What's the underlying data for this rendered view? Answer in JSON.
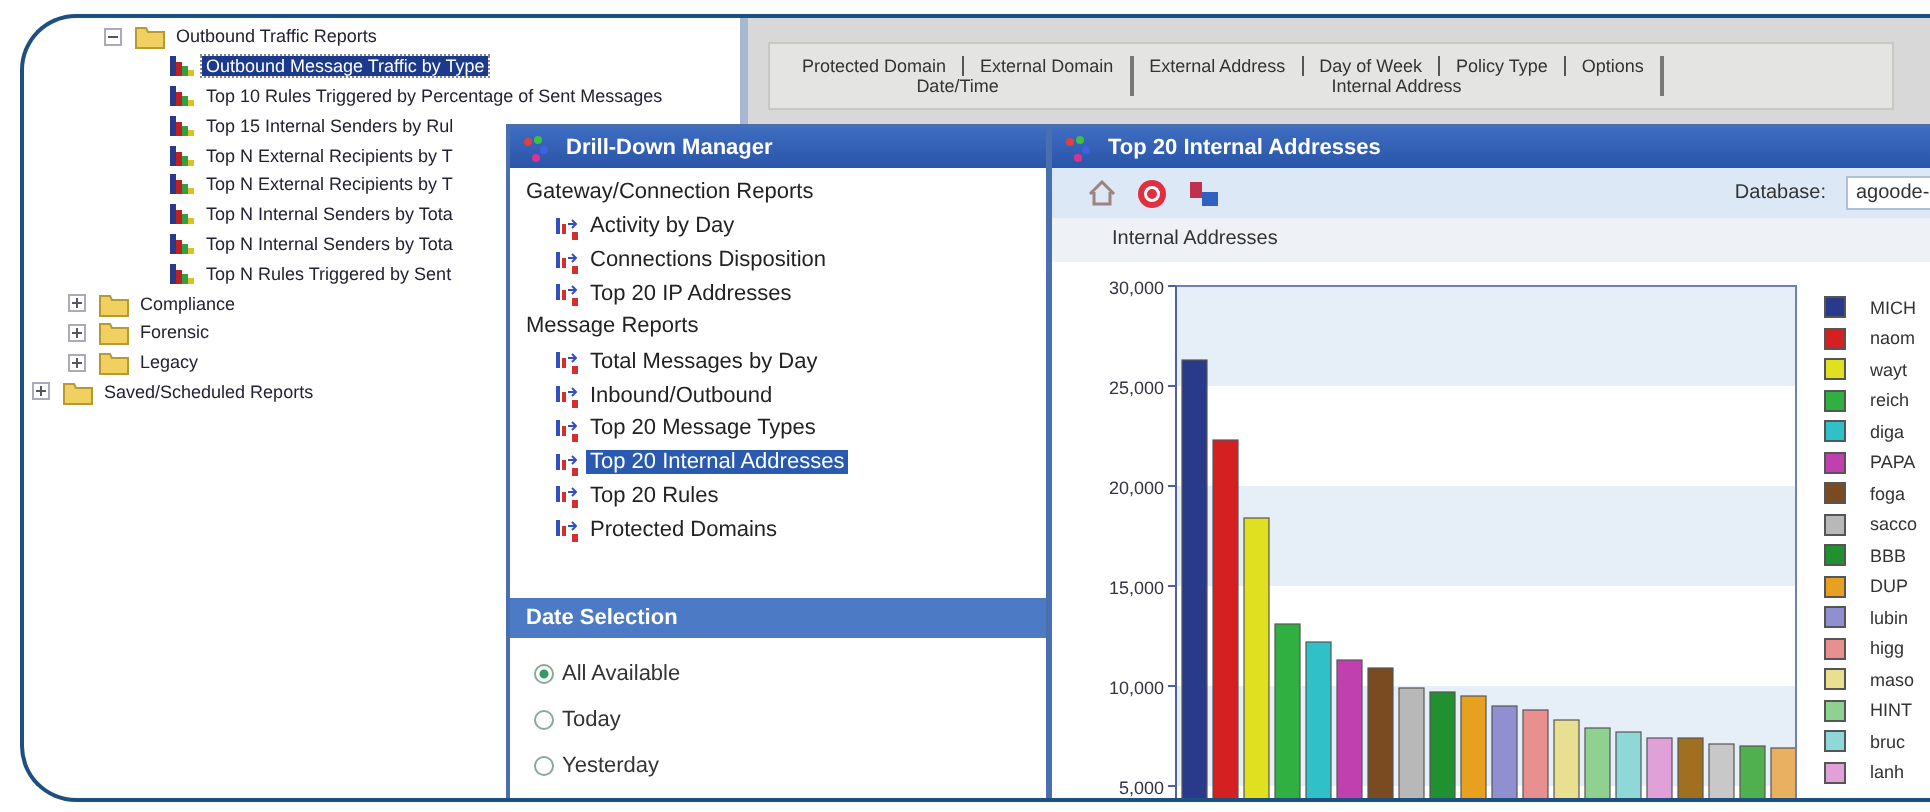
{
  "tree": [
    {
      "kind": "continued",
      "children": [
        {
          "kind": "continued",
          "children": [
            {
              "kind": "folder",
              "label": "Outbound Traffic Reports",
              "expanded": true,
              "selected": false,
              "children": [
                {
                  "kind": "report",
                  "label": "Outbound Message Traffic by Type",
                  "selected": true
                },
                {
                  "kind": "report",
                  "label": "Top 10 Rules Triggered by Percentage of Sent Messages",
                  "selected": false
                },
                {
                  "kind": "report",
                  "label": "Top 15 Internal Senders by Rul",
                  "selected": false
                },
                {
                  "kind": "report",
                  "label": "Top N External Recipients by T",
                  "selected": false
                },
                {
                  "kind": "report",
                  "label": "Top N External Recipients by T",
                  "selected": false
                },
                {
                  "kind": "report",
                  "label": "Top N Internal Senders by Tota",
                  "selected": false
                },
                {
                  "kind": "report",
                  "label": "Top N Internal Senders by Tota",
                  "selected": false
                },
                {
                  "kind": "report",
                  "label": "Top N Rules Triggered by Sent",
                  "selected": false
                }
              ]
            }
          ]
        },
        {
          "kind": "folder",
          "label": "Compliance",
          "expanded": false,
          "selected": false
        },
        {
          "kind": "folder",
          "label": "Forensic",
          "expanded": false,
          "selected": false
        },
        {
          "kind": "folder",
          "label": "Legacy",
          "expanded": false,
          "selected": false
        }
      ]
    },
    {
      "kind": "folder",
      "label": "Saved/Scheduled Reports",
      "expanded": false,
      "selected": false
    }
  ],
  "field_groups": [
    {
      "fields": [
        "Protected Domain",
        "External Domain"
      ],
      "base": "Date/Time"
    },
    {
      "fields": [
        "External Address",
        "Day of Week",
        "Policy Type",
        "Options"
      ],
      "base": "Internal Address"
    }
  ],
  "drill_down": {
    "title": "Drill-Down Manager",
    "groups": [
      {
        "label": "Gateway/Connection Reports",
        "items": [
          {
            "label": "Activity by Day",
            "selected": false
          },
          {
            "label": "Connections Disposition",
            "selected": false
          },
          {
            "label": "Top 20 IP Addresses",
            "selected": false
          }
        ]
      },
      {
        "label": "Message Reports",
        "items": [
          {
            "label": "Total Messages by Day",
            "selected": false
          },
          {
            "label": "Inbound/Outbound",
            "selected": false
          },
          {
            "label": "Top 20 Message Types",
            "selected": false
          },
          {
            "label": "Top 20 Internal Addresses",
            "selected": true
          },
          {
            "label": "Top 20 Rules",
            "selected": false
          },
          {
            "label": "Protected Domains",
            "selected": false
          }
        ]
      }
    ],
    "date_selection": {
      "title": "Date Selection",
      "options": [
        {
          "label": "All Available",
          "selected": true
        },
        {
          "label": "Today",
          "selected": false
        },
        {
          "label": "Yesterday",
          "selected": false
        }
      ]
    }
  },
  "report_window": {
    "title": "Top 20 Internal Addresses",
    "database_label": "Database:",
    "database_value": "agoode-",
    "subtitle": "Internal Addresses",
    "chart_data": {
      "type": "bar",
      "ylim": [
        4000,
        30000
      ],
      "yticks": [
        {
          "value": 5000,
          "label": "5,000"
        },
        {
          "value": 10000,
          "label": "10,000"
        },
        {
          "value": 15000,
          "label": "15,000"
        },
        {
          "value": 20000,
          "label": "20,000"
        },
        {
          "value": 25000,
          "label": "25,000"
        },
        {
          "value": 30000,
          "label": "30,000"
        }
      ],
      "values": [
        26300,
        22300,
        18400,
        13100,
        12200,
        11300,
        10900,
        9900,
        9700,
        9500,
        9000,
        8800,
        8300,
        7900,
        7700,
        7400,
        7400,
        7100,
        7000,
        6900
      ],
      "colors": [
        "#2a3a8a",
        "#d42020",
        "#e0e020",
        "#30b040",
        "#30c0c8",
        "#c040b0",
        "#7a4a20",
        "#b8b8b8",
        "#209030",
        "#e8a020",
        "#9090d0",
        "#e89090",
        "#e8e090",
        "#90d090",
        "#90d8d8",
        "#e0a0d8",
        "#a07020",
        "#c8c8c8",
        "#50b050",
        "#e8b060"
      ]
    },
    "legend": [
      {
        "label": "MICH",
        "color": "#2a3a8a"
      },
      {
        "label": "naom",
        "color": "#d42020"
      },
      {
        "label": "wayt",
        "color": "#e0e020"
      },
      {
        "label": "reich",
        "color": "#30b040"
      },
      {
        "label": "diga",
        "color": "#30c0c8"
      },
      {
        "label": "PAPA",
        "color": "#c040b0"
      },
      {
        "label": "foga",
        "color": "#7a4a20"
      },
      {
        "label": "sacco",
        "color": "#b8b8b8"
      },
      {
        "label": "BBB",
        "color": "#209030"
      },
      {
        "label": "DUP",
        "color": "#e8a020"
      },
      {
        "label": "lubin",
        "color": "#9090d0"
      },
      {
        "label": "higg",
        "color": "#e89090"
      },
      {
        "label": "maso",
        "color": "#e8e090"
      },
      {
        "label": "HINT",
        "color": "#90d090"
      },
      {
        "label": "bruc",
        "color": "#90d8d8"
      },
      {
        "label": "lanh",
        "color": "#e0a0d8"
      }
    ]
  }
}
